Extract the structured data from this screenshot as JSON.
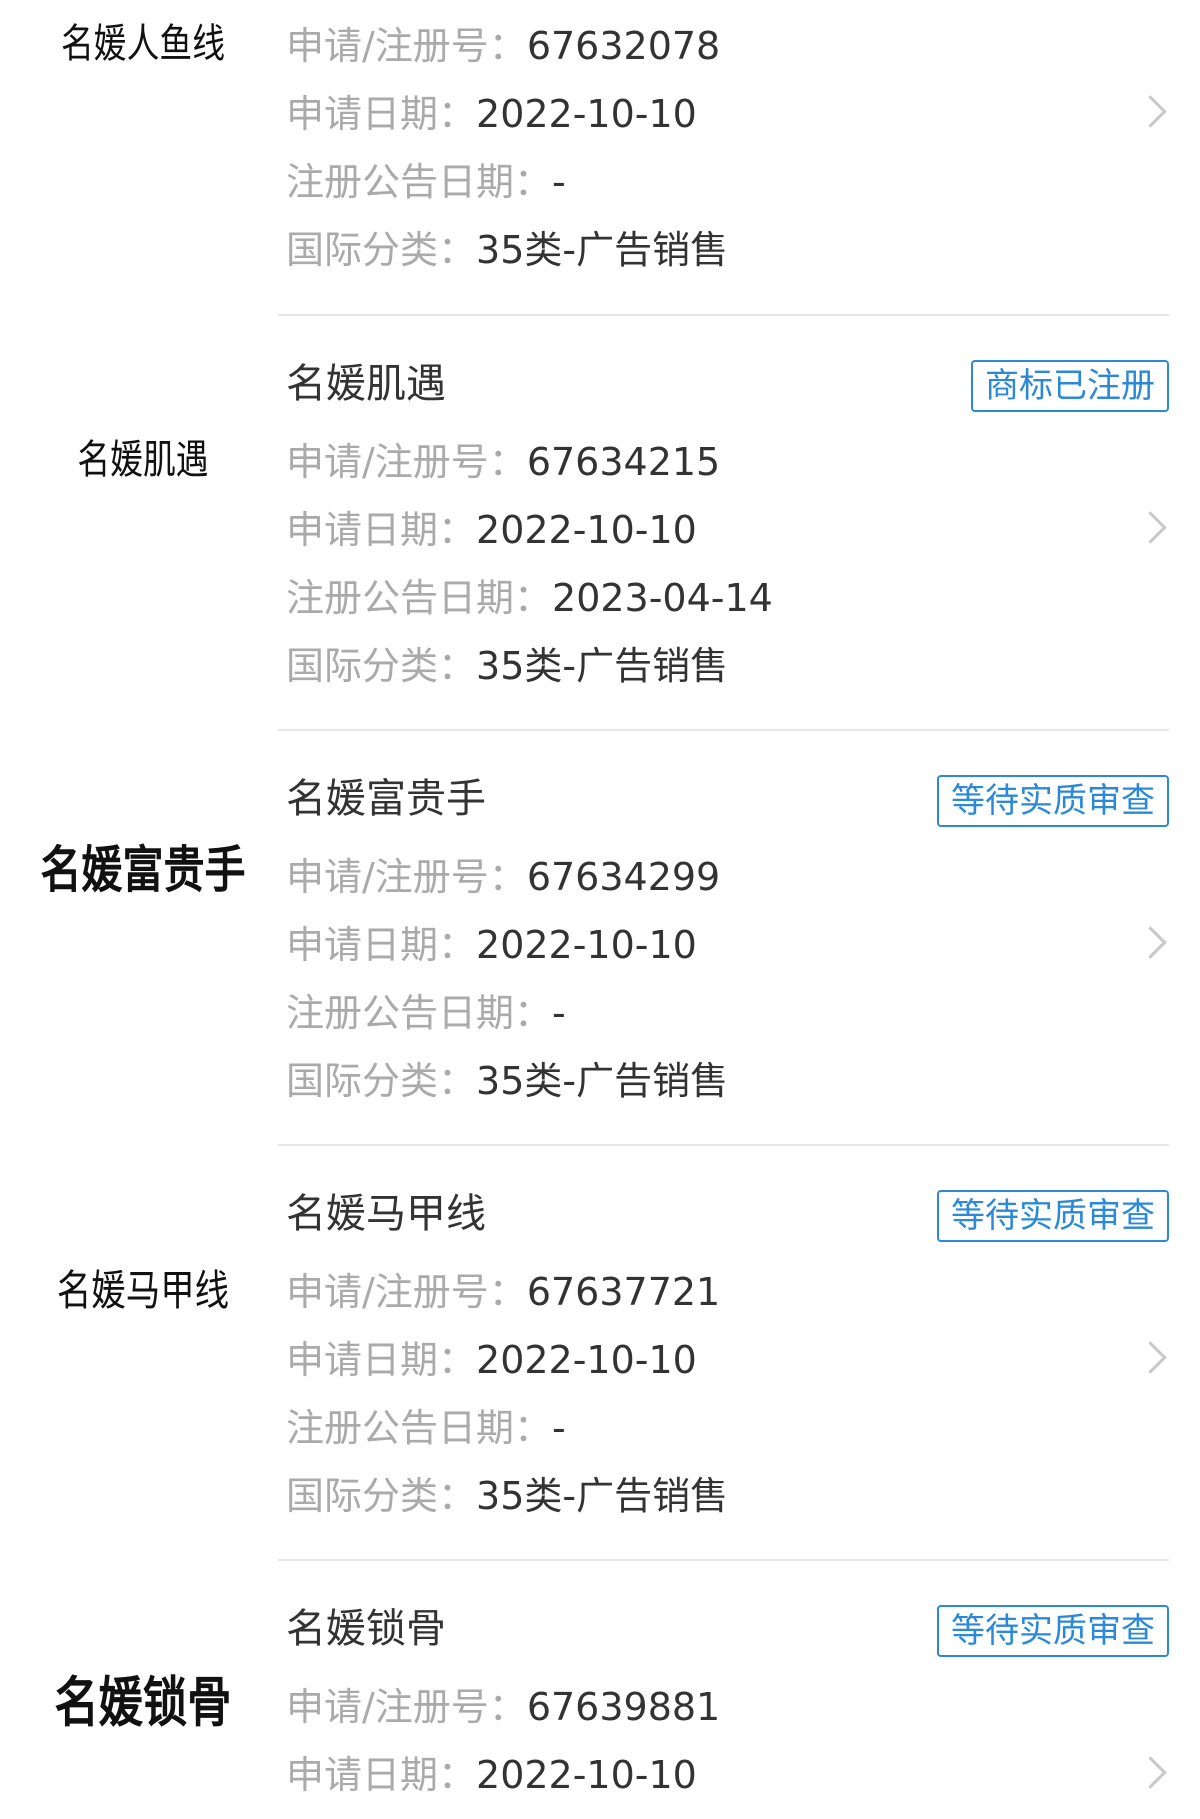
{
  "labels": {
    "reg_no": "申请/注册号：",
    "apply_date": "申请日期：",
    "announce_date": "注册公告日期：",
    "intl_class": "国际分类："
  },
  "items": [
    {
      "logo_text": "名媛人鱼线",
      "name": "",
      "status": "",
      "reg_no": "67632078",
      "apply_date": "2022-10-10",
      "announce_date": "-",
      "intl_class": "35类-广告销售"
    },
    {
      "logo_text": "名媛肌遇",
      "name": "名媛肌遇",
      "status": "商标已注册",
      "reg_no": "67634215",
      "apply_date": "2022-10-10",
      "announce_date": "2023-04-14",
      "intl_class": "35类-广告销售"
    },
    {
      "logo_text": "名媛富贵手",
      "name": "名媛富贵手",
      "status": "等待实质审查",
      "reg_no": "67634299",
      "apply_date": "2022-10-10",
      "announce_date": "-",
      "intl_class": "35类-广告销售"
    },
    {
      "logo_text": "名媛马甲线",
      "name": "名媛马甲线",
      "status": "等待实质审查",
      "reg_no": "67637721",
      "apply_date": "2022-10-10",
      "announce_date": "-",
      "intl_class": "35类-广告销售"
    },
    {
      "logo_text": "名媛锁骨",
      "name": "名媛锁骨",
      "status": "等待实质审查",
      "reg_no": "67639881",
      "apply_date": "2022-10-10",
      "announce_date": "",
      "intl_class": ""
    }
  ],
  "colors": {
    "badge_accent": "#2c89d8",
    "label_gray": "#aaaaaa",
    "value_dark": "#333333",
    "divider": "#e6e6e6"
  },
  "icons": {
    "row_chevron": "chevron-right-icon"
  }
}
